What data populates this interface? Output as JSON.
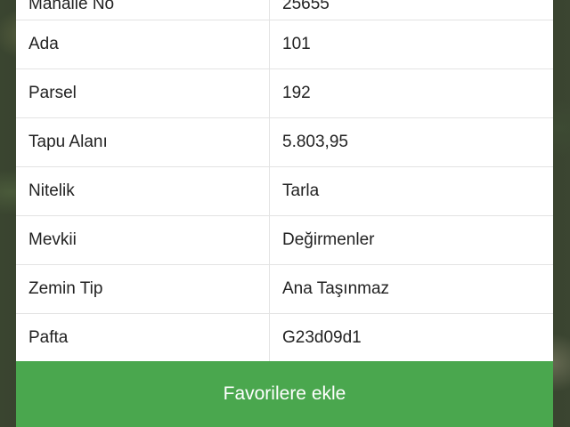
{
  "rows": [
    {
      "key": "Mahalle No",
      "value": "25655"
    },
    {
      "key": "Ada",
      "value": "101"
    },
    {
      "key": "Parsel",
      "value": "192"
    },
    {
      "key": "Tapu Alanı",
      "value": "5.803,95"
    },
    {
      "key": "Nitelik",
      "value": "Tarla"
    },
    {
      "key": "Mevkii",
      "value": "Değirmenler"
    },
    {
      "key": "Zemin Tip",
      "value": "Ana Taşınmaz"
    },
    {
      "key": "Pafta",
      "value": "G23d09d1"
    }
  ],
  "favorite_button_label": "Favorilere ekle"
}
